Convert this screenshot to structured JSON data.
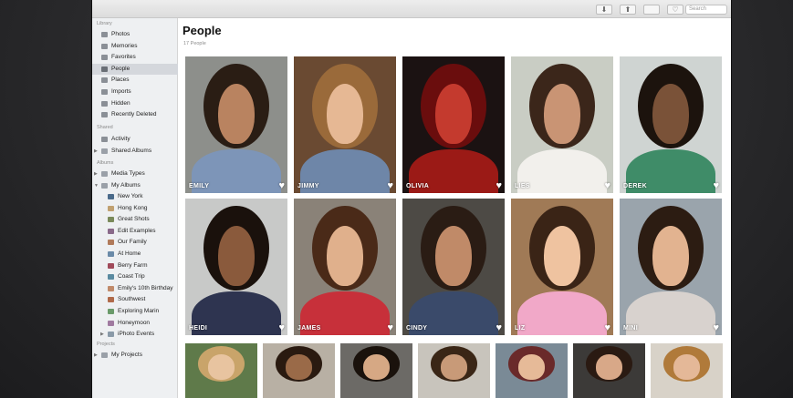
{
  "toolbar": {
    "buttons": [
      "⬇",
      "⬆",
      "",
      "♡"
    ],
    "search_placeholder": "Search"
  },
  "sidebar": {
    "library_header": "Library",
    "library": [
      {
        "label": "Photos",
        "icon": "photos-icon"
      },
      {
        "label": "Memories",
        "icon": "memories-icon"
      },
      {
        "label": "Favorites",
        "icon": "heart-icon"
      },
      {
        "label": "People",
        "icon": "person-icon",
        "selected": true
      },
      {
        "label": "Places",
        "icon": "pin-icon"
      },
      {
        "label": "Imports",
        "icon": "clock-icon"
      },
      {
        "label": "Hidden",
        "icon": "hidden-icon"
      },
      {
        "label": "Recently Deleted",
        "icon": "trash-icon"
      }
    ],
    "shared_header": "Shared",
    "shared": [
      {
        "label": "Activity",
        "icon": "cloud-icon"
      },
      {
        "label": "Shared Albums",
        "icon": "folder-icon"
      }
    ],
    "albums_header": "Albums",
    "albums": [
      {
        "label": "Media Types",
        "icon": "folder-icon"
      },
      {
        "label": "My Albums",
        "icon": "folder-icon"
      }
    ],
    "my_albums": [
      "New York",
      "Hong Kong",
      "Great Shots",
      "Edit Examples",
      "Our Family",
      "At Home",
      "Berry Farm",
      "Coast Trip",
      "Emily's 10th Birthday",
      "Southwest",
      "Exploring Marin",
      "Honeymoon",
      "iPhoto Events"
    ],
    "projects_header": "Projects",
    "projects": [
      {
        "label": "My Projects",
        "icon": "folder-icon"
      }
    ]
  },
  "main": {
    "title": "People",
    "subtitle": "17 People"
  },
  "people_row1": [
    {
      "name": "EMILY",
      "bg": "#8d8f8b",
      "skin": "#b98360",
      "hair": "#2a1d14",
      "shirt": "#7d95b8"
    },
    {
      "name": "JIMMY",
      "bg": "#6a4a32",
      "skin": "#e6b894",
      "hair": "#9a6a3a",
      "shirt": "#6e86a8"
    },
    {
      "name": "OLIVIA",
      "bg": "#1b1212",
      "skin": "#c43a2e",
      "hair": "#6a0d0d",
      "shirt": "#9b1a16"
    },
    {
      "name": "LIES",
      "bg": "#c9cdc4",
      "skin": "#c99474",
      "hair": "#3b261a",
      "shirt": "#f2f0ec"
    },
    {
      "name": "DEREK",
      "bg": "#cfd4d2",
      "skin": "#7a5238",
      "hair": "#1c130d",
      "shirt": "#3f8c68"
    }
  ],
  "people_row2": [
    {
      "name": "HEIDI",
      "bg": "#c8c9c8",
      "skin": "#8a5a3c",
      "hair": "#1a110c",
      "shirt": "#2e3450"
    },
    {
      "name": "JAMES",
      "bg": "#8a8278",
      "skin": "#e0b08c",
      "hair": "#4a2a18",
      "shirt": "#c7303a"
    },
    {
      "name": "CINDY",
      "bg": "#4d4a45",
      "skin": "#c08a68",
      "hair": "#2a1c14",
      "shirt": "#3a4a6a"
    },
    {
      "name": "LIZ",
      "bg": "#a07a56",
      "skin": "#efc3a0",
      "hair": "#3a2416",
      "shirt": "#f1a8c8"
    },
    {
      "name": "MINI",
      "bg": "#9aa4ac",
      "skin": "#e2b390",
      "hair": "#2c1c12",
      "shirt": "#d8d2ce"
    }
  ],
  "people_row3": [
    {
      "bg": "#5f7a4a",
      "skin": "#e8c4a0",
      "hair": "#c9a46a"
    },
    {
      "bg": "#b8b0a4",
      "skin": "#9a6a48",
      "hair": "#2a1a10"
    },
    {
      "bg": "#6c6a66",
      "skin": "#d6a884",
      "hair": "#1a120c"
    },
    {
      "bg": "#c8c4bc",
      "skin": "#c89a78",
      "hair": "#3a2616"
    },
    {
      "bg": "#7a8a96",
      "skin": "#e6ba98",
      "hair": "#6a2a2a"
    },
    {
      "bg": "#3c3a38",
      "skin": "#d8a888",
      "hair": "#2a1a12"
    },
    {
      "bg": "#d8d2c8",
      "skin": "#e4b898",
      "hair": "#b07a3a"
    }
  ]
}
